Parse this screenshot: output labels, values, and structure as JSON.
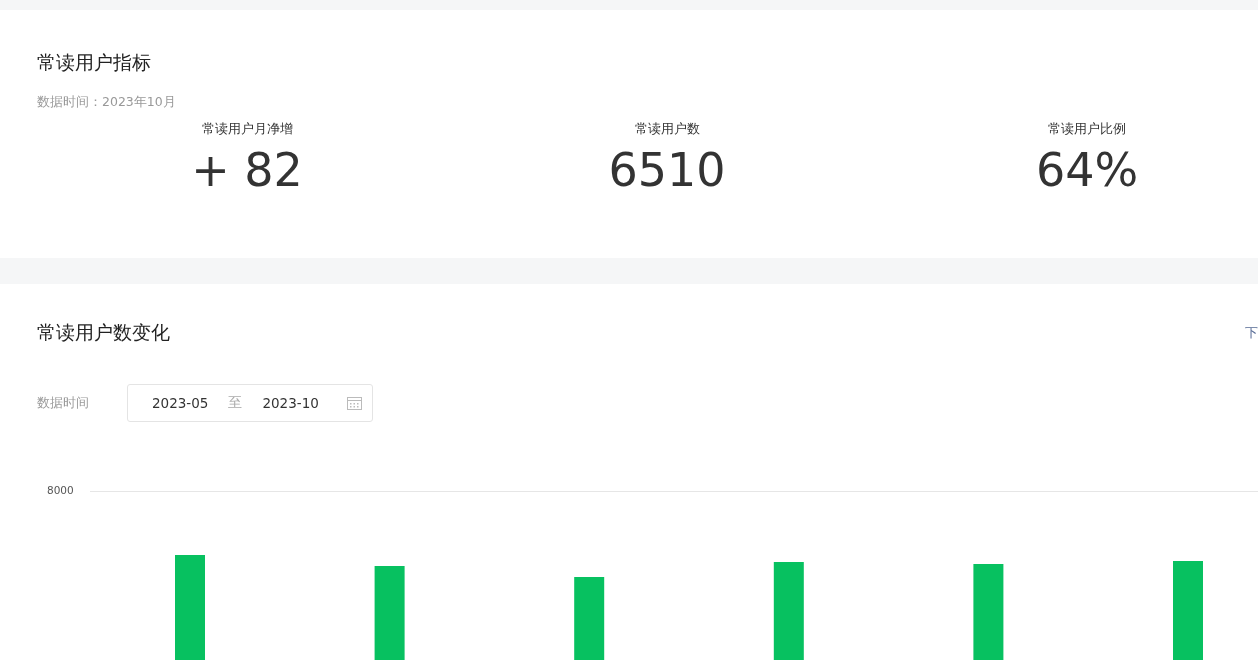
{
  "metrics_card": {
    "title": "常读用户指标",
    "data_time": "数据时间：2023年10月",
    "metrics": [
      {
        "label": "常读用户月净增",
        "value": "+ 82"
      },
      {
        "label": "常读用户数",
        "value": "6510"
      },
      {
        "label": "常读用户比例",
        "value": "64%"
      }
    ]
  },
  "trend_card": {
    "title": "常读用户数变化",
    "link": "下",
    "date_label": "数据时间",
    "date_range": {
      "start": "2023-05",
      "separator": "至",
      "end": "2023-10"
    },
    "chart": {
      "kind": "picture",
      "y_tick_label": "8000"
    }
  }
}
